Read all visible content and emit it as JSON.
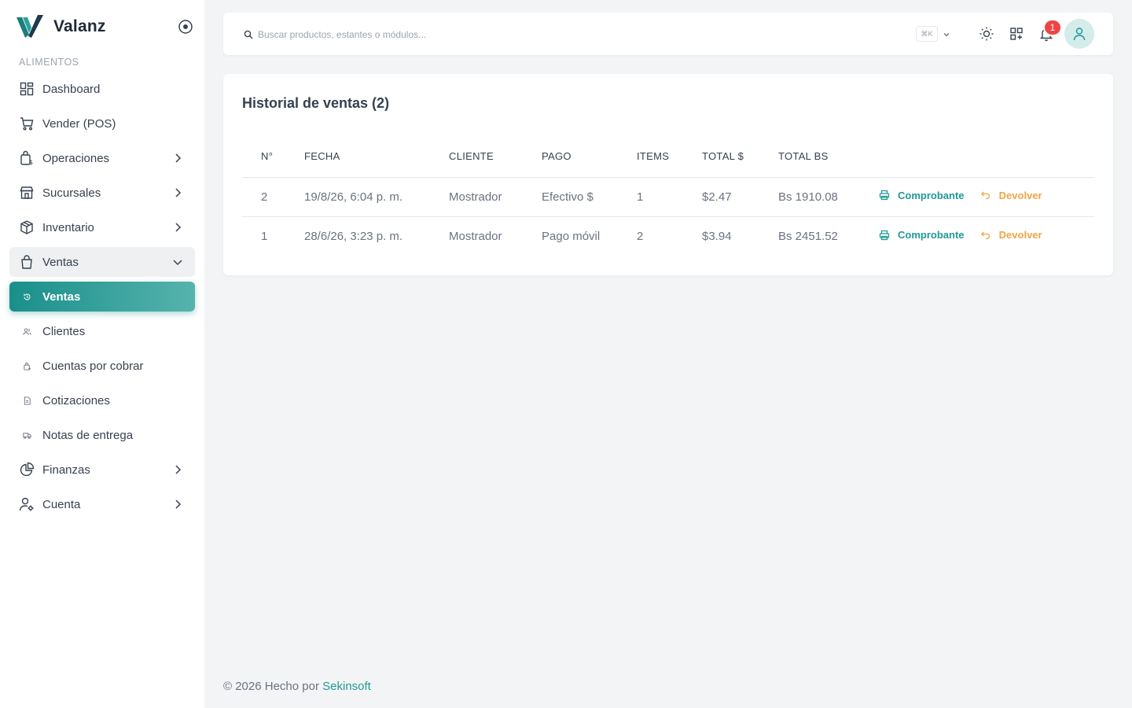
{
  "brand": {
    "name": "Valanz"
  },
  "sidebar": {
    "section": "ALIMENTOS",
    "items": [
      {
        "label": "Dashboard",
        "icon": "dashboard-icon"
      },
      {
        "label": "Vender (POS)",
        "icon": "cart-icon"
      },
      {
        "label": "Operaciones",
        "icon": "operations-icon"
      },
      {
        "label": "Sucursales",
        "icon": "store-icon"
      },
      {
        "label": "Inventario",
        "icon": "box-icon"
      },
      {
        "label": "Ventas",
        "icon": "bag-icon"
      },
      {
        "label": "Ventas",
        "icon": "history-icon"
      },
      {
        "label": "Clientes",
        "icon": "users-icon"
      },
      {
        "label": "Cuentas por cobrar",
        "icon": "receivable-icon"
      },
      {
        "label": "Cotizaciones",
        "icon": "document-icon"
      },
      {
        "label": "Notas de entrega",
        "icon": "truck-icon"
      },
      {
        "label": "Finanzas",
        "icon": "pie-chart-icon"
      },
      {
        "label": "Cuenta",
        "icon": "user-settings-icon"
      }
    ]
  },
  "topbar": {
    "search_placeholder": "Buscar productos, estantes o módulos...",
    "shortcut": "⌘K",
    "notifications_count": "1"
  },
  "sales": {
    "title": "Historial de ventas (2)",
    "columns": [
      "N°",
      "FECHA",
      "CLIENTE",
      "PAGO",
      "ITEMS",
      "TOTAL $",
      "TOTAL BS"
    ],
    "rows": [
      {
        "num": "2",
        "date": "19/8/26, 6:04 p. m.",
        "client": "Mostrador",
        "payment": "Efectivo $",
        "items": "1",
        "total_usd": "$2.47",
        "total_bs": "Bs 1910.08"
      },
      {
        "num": "1",
        "date": "28/6/26, 3:23 p. m.",
        "client": "Mostrador",
        "payment": "Pago móvil",
        "items": "2",
        "total_usd": "$3.94",
        "total_bs": "Bs 2451.52"
      }
    ],
    "action_receipt": "Comprobante",
    "action_return": "Devolver"
  },
  "footer": {
    "text": "© 2026 Hecho por ",
    "link": "Sekinsoft"
  },
  "colors": {
    "accent": "#1f9a94",
    "warning": "#f0a545",
    "badge": "#ef4444"
  }
}
